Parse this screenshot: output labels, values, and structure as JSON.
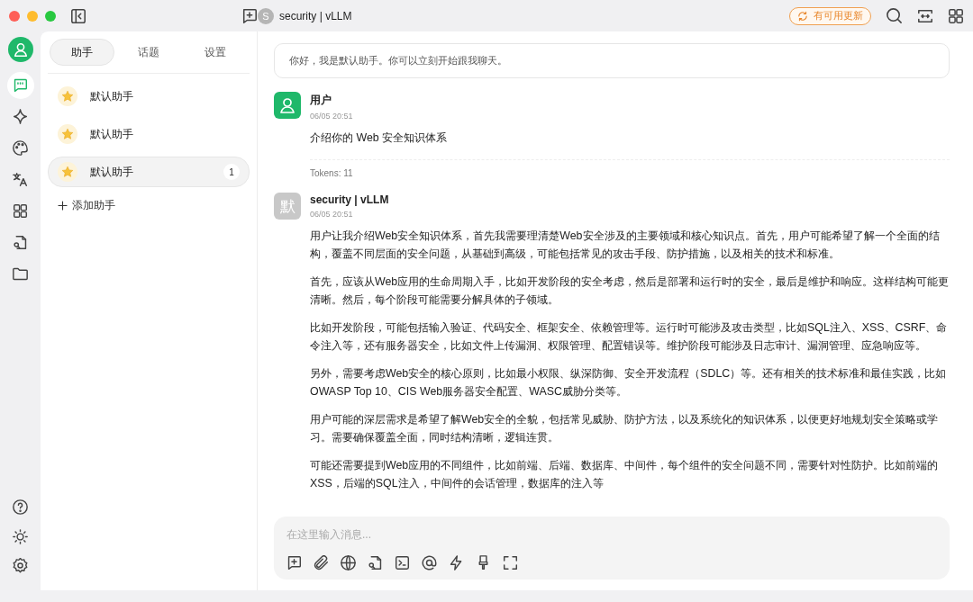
{
  "window": {
    "title": "security | vLLM",
    "avatar_letter": "S",
    "update_button": "有可用更新"
  },
  "rail": {
    "top": [
      {
        "kind": "chat",
        "selected": true
      },
      {
        "kind": "sparkle",
        "selected": false
      },
      {
        "kind": "palette",
        "selected": false
      },
      {
        "kind": "translate",
        "selected": false
      },
      {
        "kind": "apps",
        "selected": false
      },
      {
        "kind": "file-search",
        "selected": false
      },
      {
        "kind": "folder",
        "selected": false
      }
    ],
    "bottom": [
      {
        "kind": "help",
        "selected": false
      },
      {
        "kind": "sun",
        "selected": false
      },
      {
        "kind": "settings",
        "selected": false
      }
    ]
  },
  "sidebar": {
    "tabs": [
      {
        "label": "助手",
        "selected": true
      },
      {
        "label": "话题",
        "selected": false
      },
      {
        "label": "设置",
        "selected": false
      }
    ],
    "assistants": [
      {
        "name": "默认助手",
        "selected": false
      },
      {
        "name": "默认助手",
        "selected": false
      },
      {
        "name": "默认助手",
        "selected": true,
        "count": "1"
      }
    ],
    "add_button": "添加助手"
  },
  "chat": {
    "greeting": "你好，我是默认助手。你可以立刻开始跟我聊天。",
    "messages": [
      {
        "kind": "user",
        "author": "用户",
        "time": "06/05 20:51",
        "paragraphs": [
          "介绍你的 Web 安全知识体系"
        ],
        "tokens": "Tokens: 11"
      },
      {
        "kind": "assistant",
        "avatar_text": "默",
        "author": "security | vLLM",
        "time": "06/05 20:51",
        "paragraphs": [
          "用户让我介绍Web安全知识体系，首先我需要理清楚Web安全涉及的主要领域和核心知识点。首先，用户可能希望了解一个全面的结构，覆盖不同层面的安全问题，从基础到高级，可能包括常见的攻击手段、防护措施，以及相关的技术和标准。",
          "首先，应该从Web应用的生命周期入手，比如开发阶段的安全考虑，然后是部署和运行时的安全，最后是维护和响应。这样结构可能更清晰。然后，每个阶段可能需要分解具体的子领域。",
          "比如开发阶段，可能包括输入验证、代码安全、框架安全、依赖管理等。运行时可能涉及攻击类型，比如SQL注入、XSS、CSRF、命令注入等，还有服务器安全，比如文件上传漏洞、权限管理、配置错误等。维护阶段可能涉及日志审计、漏洞管理、应急响应等。",
          "另外，需要考虑Web安全的核心原则，比如最小权限、纵深防御、安全开发流程（SDLC）等。还有相关的技术标准和最佳实践，比如OWASP Top 10、CIS Web服务器安全配置、WASC威胁分类等。",
          "用户可能的深层需求是希望了解Web安全的全貌，包括常见威胁、防护方法，以及系统化的知识体系，以便更好地规划安全策略或学习。需要确保覆盖全面，同时结构清晰，逻辑连贯。",
          "可能还需要提到Web应用的不同组件，比如前端、后端、数据库、中间件，每个组件的安全问题不同，需要针对性防护。比如前端的XSS，后端的SQL注入，中间件的会话管理，数据库的注入等"
        ]
      }
    ],
    "composer": {
      "placeholder": "在这里输入消息..."
    }
  }
}
